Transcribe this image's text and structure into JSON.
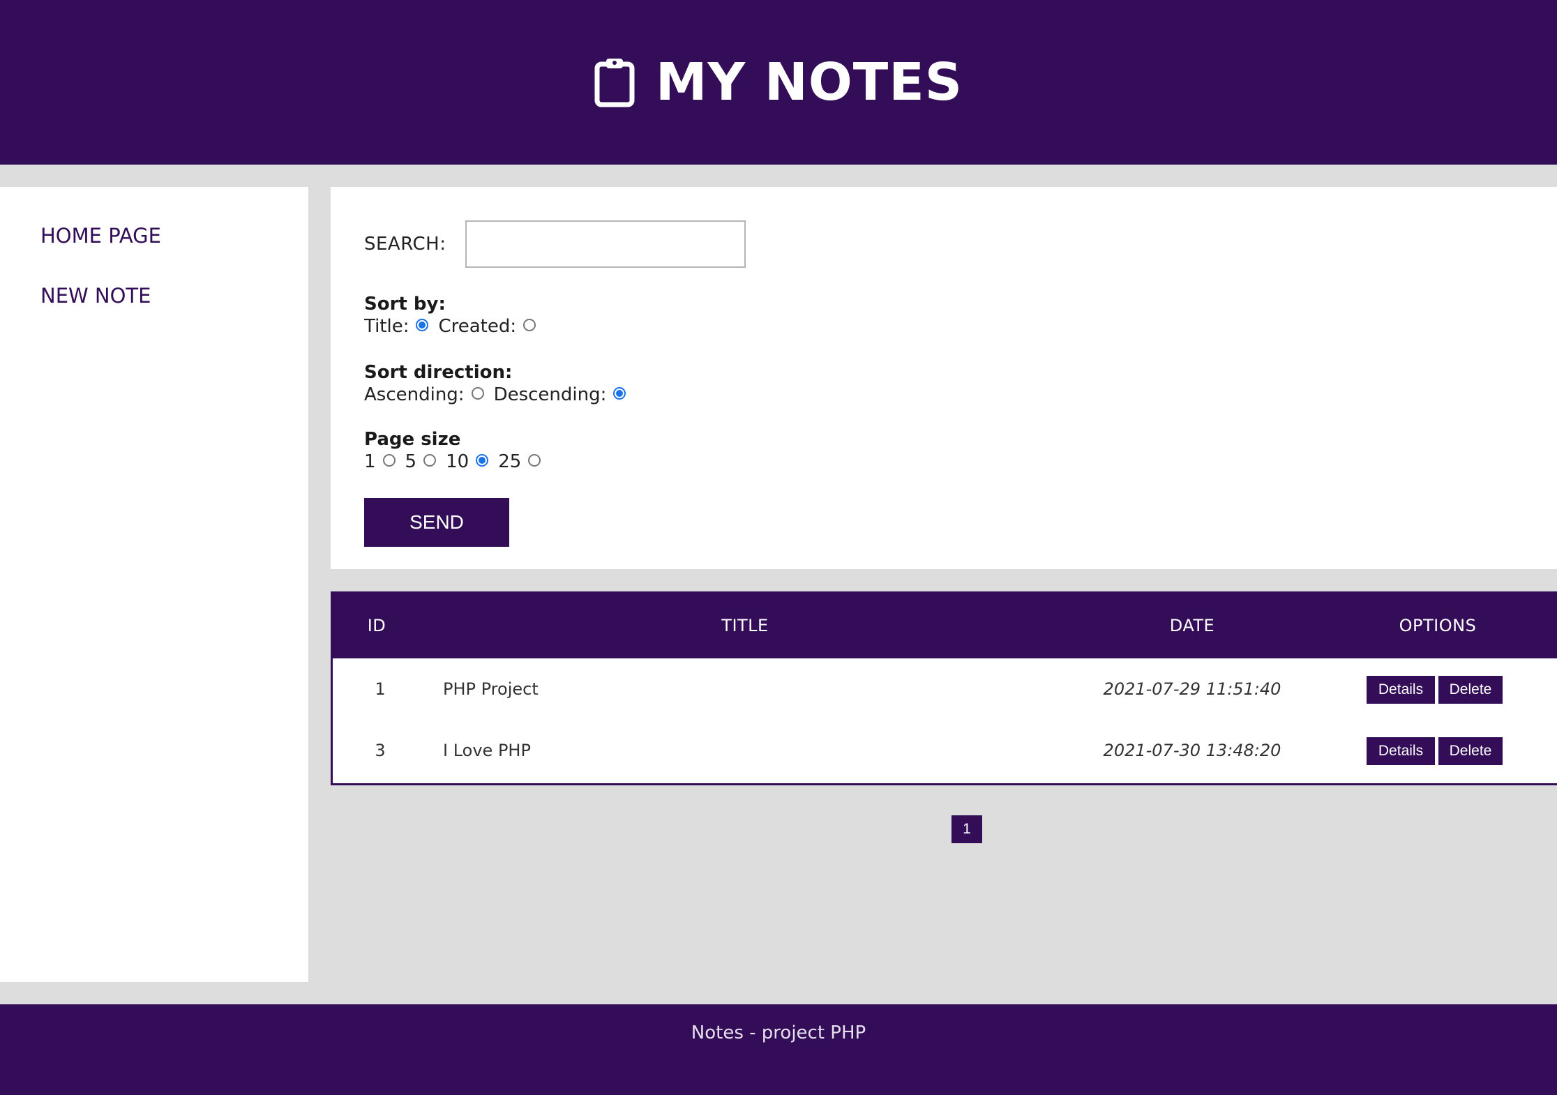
{
  "header": {
    "title": "MY NOTES",
    "icon": "clipboard-icon"
  },
  "sidebar": {
    "items": [
      {
        "label": "HOME PAGE"
      },
      {
        "label": "NEW NOTE"
      }
    ]
  },
  "form": {
    "search_label": "SEARCH:",
    "search_value": "",
    "sort_by": {
      "title": "Sort by:",
      "options": [
        {
          "label": "Title:",
          "checked": true
        },
        {
          "label": "Created:",
          "checked": false
        }
      ]
    },
    "sort_direction": {
      "title": "Sort direction:",
      "options": [
        {
          "label": "Ascending:",
          "checked": false
        },
        {
          "label": "Descending:",
          "checked": true
        }
      ]
    },
    "page_size": {
      "title": "Page size",
      "options": [
        {
          "label": "1",
          "checked": false
        },
        {
          "label": "5",
          "checked": false
        },
        {
          "label": "10",
          "checked": true
        },
        {
          "label": "25",
          "checked": false
        }
      ]
    },
    "send_label": "SEND"
  },
  "table": {
    "headers": {
      "id": "ID",
      "title": "TITLE",
      "date": "DATE",
      "options": "OPTIONS"
    },
    "rows": [
      {
        "id": "1",
        "title": "PHP Project",
        "date": "2021-07-29 11:51:40",
        "details": "Details",
        "delete": "Delete"
      },
      {
        "id": "3",
        "title": "I Love PHP",
        "date": "2021-07-30 13:48:20",
        "details": "Details",
        "delete": "Delete"
      }
    ]
  },
  "pagination": {
    "pages": [
      "1"
    ]
  },
  "footer": {
    "text": "Notes - project PHP"
  },
  "colors": {
    "primary": "#330d57",
    "background": "#dddddd",
    "panel": "#ffffff",
    "radio_checked": "#1a73e8"
  }
}
